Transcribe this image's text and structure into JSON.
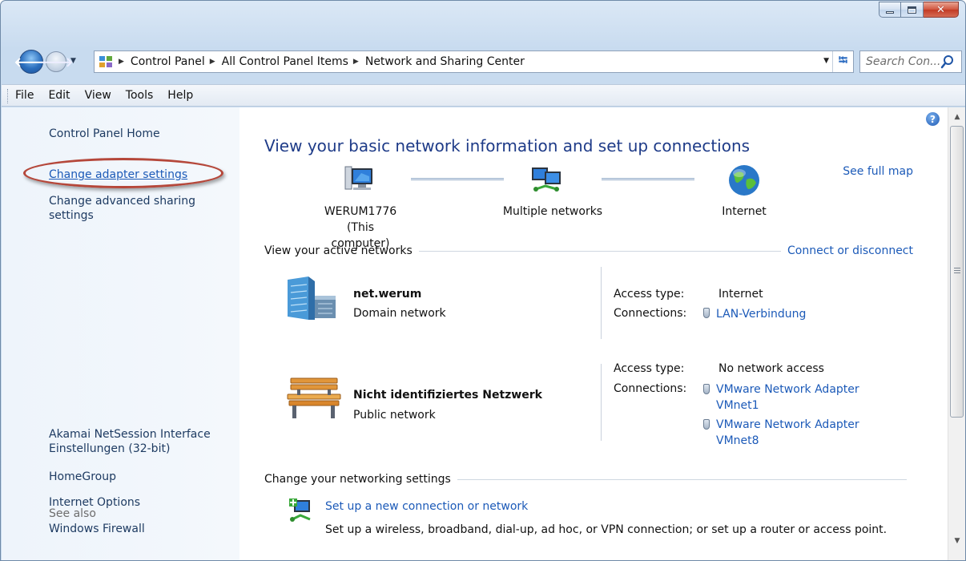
{
  "window": {
    "caption_buttons": [
      "minimize",
      "maximize",
      "close"
    ]
  },
  "address_bar": {
    "breadcrumbs": [
      "Control Panel",
      "All Control Panel Items",
      "Network and Sharing Center"
    ],
    "search_placeholder": "Search Con..."
  },
  "menu": [
    "File",
    "Edit",
    "View",
    "Tools",
    "Help"
  ],
  "sidebar": {
    "home": "Control Panel Home",
    "links": [
      "Change adapter settings",
      "Change advanced sharing settings"
    ],
    "see_also_label": "See also",
    "see_also": [
      "Akamai NetSession Interface Einstellungen (32-bit)",
      "HomeGroup",
      "Internet Options",
      "Windows Firewall"
    ]
  },
  "main": {
    "title": "View your basic network information and set up connections",
    "see_full_map": "See full map",
    "map_nodes": {
      "computer_name": "WERUM1776",
      "computer_sub": "(This computer)",
      "middle": "Multiple networks",
      "internet": "Internet"
    },
    "active_networks": {
      "heading": "View your active networks",
      "connect_link": "Connect or disconnect",
      "networks": [
        {
          "name": "net.werum",
          "category": "Domain network",
          "access_label": "Access type:",
          "access_value": "Internet",
          "connections_label": "Connections:",
          "connections": [
            "LAN-Verbindung"
          ]
        },
        {
          "name": "Nicht identifiziertes Netzwerk",
          "category": "Public network",
          "access_label": "Access type:",
          "access_value": "No network access",
          "connections_label": "Connections:",
          "connections": [
            "VMware Network Adapter VMnet1",
            "VMware Network Adapter VMnet8"
          ]
        }
      ]
    },
    "change_settings": {
      "heading": "Change your networking settings",
      "task_link": "Set up a new connection or network",
      "task_desc": "Set up a wireless, broadband, dial-up, ad hoc, or VPN connection; or set up a router or access point."
    }
  }
}
